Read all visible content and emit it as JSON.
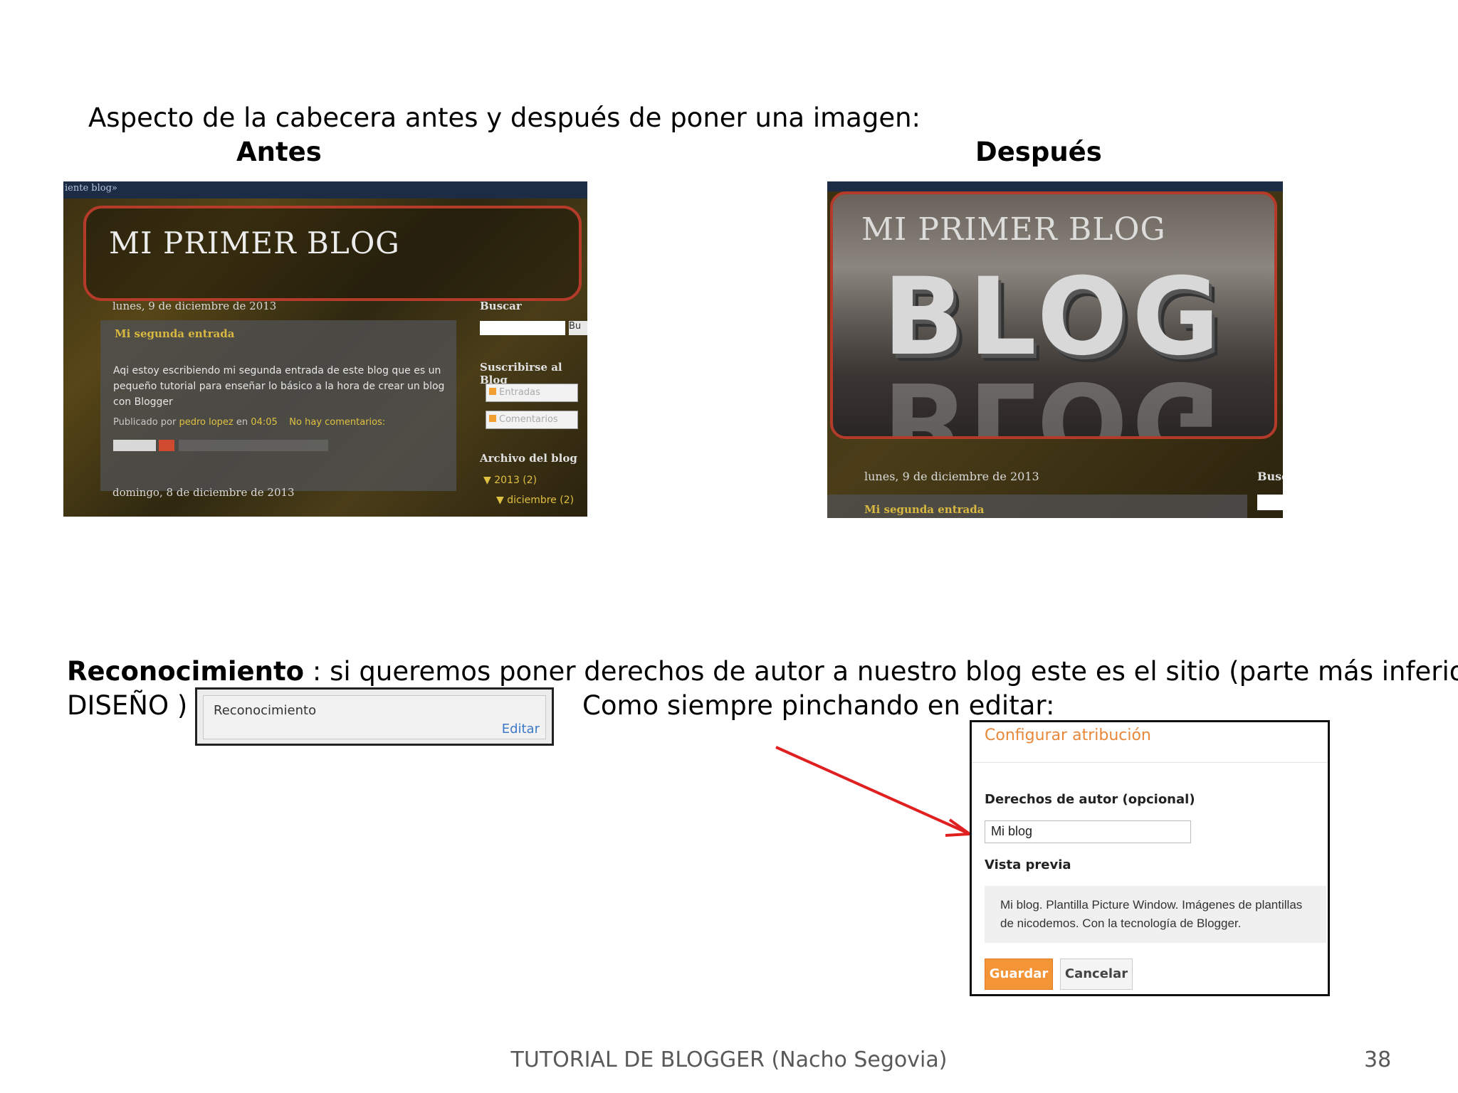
{
  "slide": {
    "intro": "Aspecto de la cabecera antes y después de poner una imagen:",
    "before_label": "Antes",
    "after_label": "Después",
    "recon_bold": "Reconocimiento",
    "recon_rest": " : si queremos poner derechos de autor a nuestro blog este es el sitio (parte más inferior de",
    "diseno": "DISEÑO ) .",
    "como": "Como siempre pinchando en editar:",
    "footer": "TUTORIAL DE BLOGGER (Nacho Segovia)",
    "page_number": "38"
  },
  "before": {
    "topbar_text": "iente blog»",
    "blog_title": "MI PRIMER BLOG",
    "date": "lunes, 9 de diciembre de 2013",
    "post_title": "Mi segunda entrada",
    "post_body": "Aqi estoy escribiendo mi segunda entrada de este blog que es un pequeño tutorial para enseñar lo básico a la hora de crear un blog con Blogger",
    "post_meta_prefix": "Publicado por",
    "post_author": "pedro lopez",
    "post_meta_en": "en",
    "post_time": "04:05",
    "post_comments": "No hay comentarios:",
    "date2": "domingo, 8 de diciembre de 2013",
    "buscar": "Buscar",
    "search_button": "Bu",
    "subscribe": "Suscribirse al Blog",
    "feed_entries": "Entradas",
    "feed_comments": "Comentarios",
    "archive": "Archivo del blog",
    "archive_year": "▼ 2013 (2)",
    "archive_month": "▼ diciembre (2)"
  },
  "after": {
    "blog_title": "MI PRIMER BLOG",
    "header_image_text": "BLOG",
    "date": "lunes, 9 de diciembre de 2013",
    "buscar": "Busc",
    "post_title": "Mi segunda entrada"
  },
  "widget": {
    "label": "Reconocimiento",
    "edit": "Editar"
  },
  "dialog": {
    "title": "Configurar atribución",
    "copyright_label": "Derechos de autor (opcional)",
    "copyright_value": "Mi blog",
    "preview_label": "Vista previa",
    "preview_line1": "Mi blog. Plantilla Picture Window. Imágenes de plantillas",
    "preview_line2": "de nicodemos. Con la tecnología de Blogger.",
    "save": "Guardar",
    "cancel": "Cancelar"
  },
  "colors": {
    "accent_orange": "#f39436",
    "dialog_title": "#e8883a",
    "link_blue": "#3b78c8",
    "arrow_red": "#e02020",
    "header_border": "#b43a2a"
  }
}
